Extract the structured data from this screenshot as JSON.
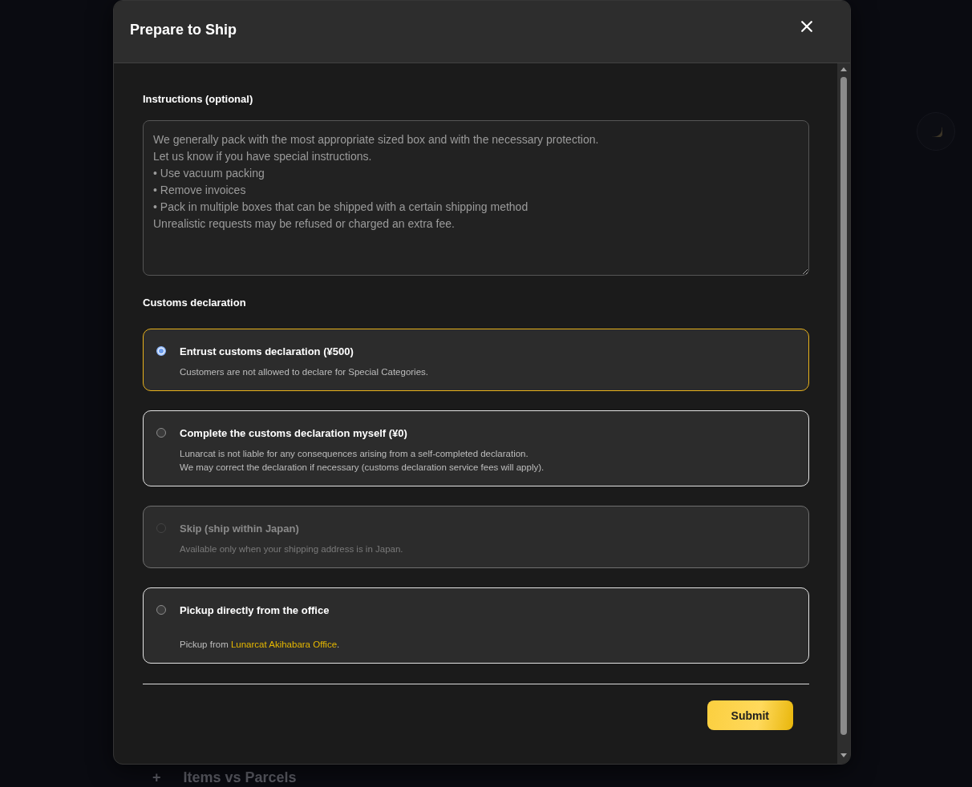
{
  "background": {
    "section": {
      "expand_mark": "+",
      "title": "Items vs Parcels"
    }
  },
  "dialog": {
    "title": "Prepare to Ship"
  },
  "instructions": {
    "label": "Instructions (optional)",
    "placeholder": "We generally pack with the most appropriate sized box and with the necessary protection.\nLet us know if you have special instructions.\n• Use vacuum packing\n• Remove invoices\n• Pack in multiple boxes that can be shipped with a certain shipping method\nUnrealistic requests may be refused or charged an extra fee."
  },
  "customs": {
    "label": "Customs declaration",
    "options": [
      {
        "title": "Entrust customs declaration (¥500)",
        "description": [
          "Customers are not allowed to declare for Special Categories."
        ],
        "selected": true,
        "disabled": false
      },
      {
        "title": "Complete the customs declaration myself (¥0)",
        "description": [
          "Lunarcat is not liable for any consequences arising from a self-completed declaration.",
          "We may correct the declaration if necessary (customs declaration service fees will apply)."
        ],
        "selected": false,
        "disabled": false
      },
      {
        "title": "Skip (ship within Japan)",
        "description": [
          "Available only when your shipping address is in Japan."
        ],
        "selected": false,
        "disabled": true
      },
      {
        "title": "Pickup directly from the office",
        "link_line": {
          "before": "Pickup from",
          "link": "Lunarcat Akihabara Office",
          "after": "."
        },
        "selected": false,
        "disabled": false
      }
    ]
  },
  "submit_button": "Submit"
}
